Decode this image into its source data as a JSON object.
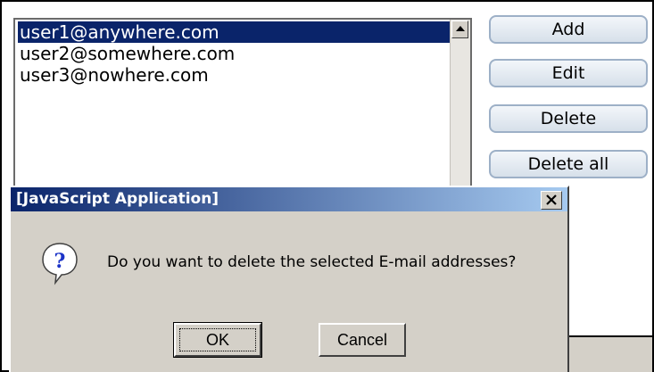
{
  "email_list": {
    "items": [
      {
        "address": "user1@anywhere.com",
        "selected": true
      },
      {
        "address": "user2@somewhere.com",
        "selected": false
      },
      {
        "address": "user3@nowhere.com",
        "selected": false
      }
    ]
  },
  "actions": {
    "add_label": "Add",
    "edit_label": "Edit",
    "delete_label": "Delete",
    "delete_all_label": "Delete all"
  },
  "dialog": {
    "title": "[JavaScript Application]",
    "message": "Do you want to delete the selected E-mail addresses?",
    "ok_label": "OK",
    "cancel_label": "Cancel",
    "icon": "question-icon"
  },
  "colors": {
    "selection": "#0a246a",
    "titlebar_start": "#0a246a",
    "titlebar_end": "#a6caf0",
    "button_border": "#9db0c7"
  }
}
